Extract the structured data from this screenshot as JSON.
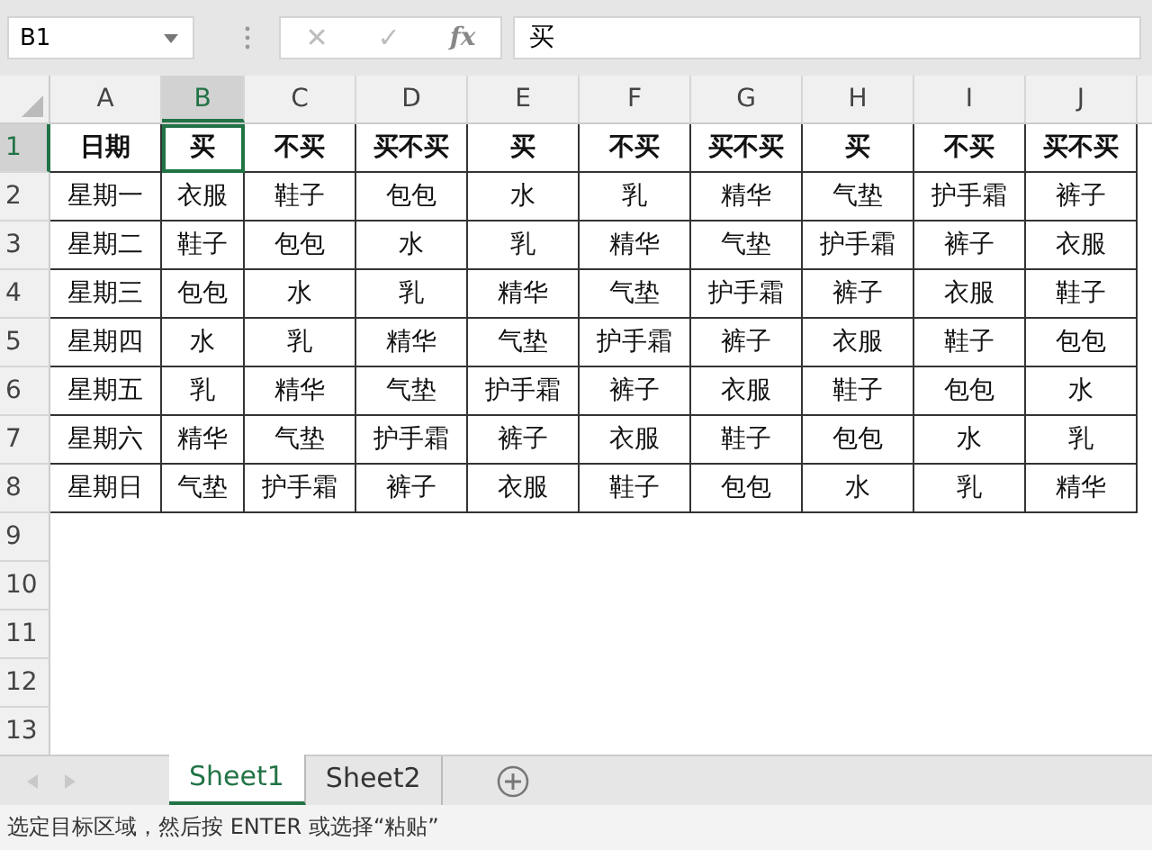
{
  "name_box": {
    "value": "B1"
  },
  "formula_bar": {
    "cancel": "✕",
    "enter": "✓",
    "function": "fx",
    "value": "买"
  },
  "columns": [
    {
      "label": "A",
      "selected": false
    },
    {
      "label": "B",
      "selected": true
    },
    {
      "label": "C",
      "selected": false
    },
    {
      "label": "D",
      "selected": false
    },
    {
      "label": "E",
      "selected": false
    },
    {
      "label": "F",
      "selected": false
    },
    {
      "label": "G",
      "selected": false
    },
    {
      "label": "H",
      "selected": false
    },
    {
      "label": "I",
      "selected": false
    },
    {
      "label": "J",
      "selected": false
    }
  ],
  "rows": [
    {
      "number": "1",
      "selected": true,
      "kind": "header",
      "cells": [
        "日期",
        "买",
        "不买",
        "买不买",
        "买",
        "不买",
        "买不买",
        "买",
        "不买",
        "买不买"
      ]
    },
    {
      "number": "2",
      "selected": false,
      "kind": "data",
      "cells": [
        "星期一",
        "衣服",
        "鞋子",
        "包包",
        "水",
        "乳",
        "精华",
        "气垫",
        "护手霜",
        "裤子"
      ]
    },
    {
      "number": "3",
      "selected": false,
      "kind": "data",
      "cells": [
        "星期二",
        "鞋子",
        "包包",
        "水",
        "乳",
        "精华",
        "气垫",
        "护手霜",
        "裤子",
        "衣服"
      ]
    },
    {
      "number": "4",
      "selected": false,
      "kind": "data",
      "cells": [
        "星期三",
        "包包",
        "水",
        "乳",
        "精华",
        "气垫",
        "护手霜",
        "裤子",
        "衣服",
        "鞋子"
      ]
    },
    {
      "number": "5",
      "selected": false,
      "kind": "data",
      "cells": [
        "星期四",
        "水",
        "乳",
        "精华",
        "气垫",
        "护手霜",
        "裤子",
        "衣服",
        "鞋子",
        "包包"
      ]
    },
    {
      "number": "6",
      "selected": false,
      "kind": "data",
      "cells": [
        "星期五",
        "乳",
        "精华",
        "气垫",
        "护手霜",
        "裤子",
        "衣服",
        "鞋子",
        "包包",
        "水"
      ]
    },
    {
      "number": "7",
      "selected": false,
      "kind": "data",
      "cells": [
        "星期六",
        "精华",
        "气垫",
        "护手霜",
        "裤子",
        "衣服",
        "鞋子",
        "包包",
        "水",
        "乳"
      ]
    },
    {
      "number": "8",
      "selected": false,
      "kind": "data",
      "cells": [
        "星期日",
        "气垫",
        "护手霜",
        "裤子",
        "衣服",
        "鞋子",
        "包包",
        "水",
        "乳",
        "精华"
      ]
    },
    {
      "number": "9",
      "selected": false,
      "kind": "empty"
    },
    {
      "number": "10",
      "selected": false,
      "kind": "empty"
    },
    {
      "number": "11",
      "selected": false,
      "kind": "empty"
    },
    {
      "number": "12",
      "selected": false,
      "kind": "empty"
    },
    {
      "number": "13",
      "selected": false,
      "kind": "empty"
    }
  ],
  "sheet_tabs": [
    {
      "label": "Sheet1",
      "selected": true
    },
    {
      "label": "Sheet2",
      "selected": false
    }
  ],
  "status_bar": {
    "message": "选定目标区域，然后按 ENTER 或选择“粘贴”"
  }
}
